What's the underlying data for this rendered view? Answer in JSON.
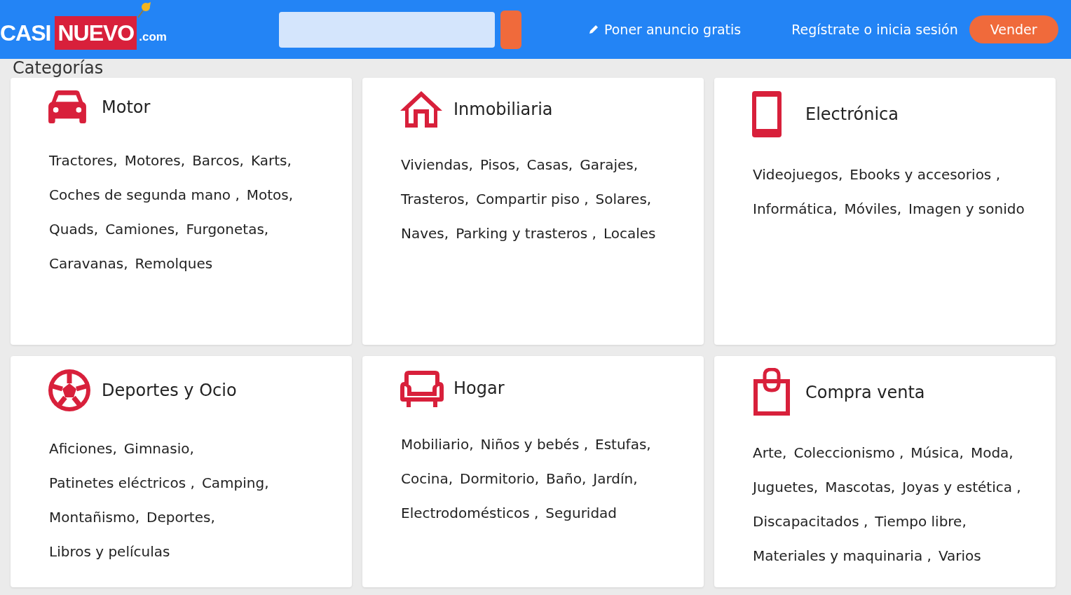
{
  "header": {
    "logo": {
      "first": "CASI",
      "second": "NUEVO",
      "suffix": ".com"
    },
    "post_ad": "Poner anuncio gratis",
    "account": "Regístrate o inicia sesión",
    "sell_button": "Vender"
  },
  "heading": "Categorías",
  "categories": [
    {
      "title": "Motor",
      "items": [
        "Tractores,",
        "Motores,",
        "Barcos,",
        "Karts,",
        "Coches de segunda mano ,",
        "Motos,",
        "Quads,",
        "Camiones,",
        "Furgonetas,",
        "Caravanas,",
        "Remolques"
      ]
    },
    {
      "title": "Inmobiliaria",
      "items": [
        "Viviendas,",
        "Pisos,",
        "Casas,",
        "Garajes,",
        "Trasteros,",
        "Compartir piso ,",
        "Solares,",
        "Naves,",
        "Parking y trasteros ,",
        "Locales"
      ]
    },
    {
      "title": "Electrónica",
      "items": [
        "Videojuegos,",
        "Ebooks y accesorios ,",
        "Informática,",
        "Móviles,",
        "Imagen y sonido"
      ]
    },
    {
      "title": "Deportes y Ocio",
      "items": [
        "Aficiones,",
        "Gimnasio,",
        "Patinetes eléctricos ,",
        "Camping,",
        "Montañismo,",
        "Deportes,",
        "Libros y películas"
      ]
    },
    {
      "title": "Hogar",
      "items": [
        "Mobiliario,",
        "Niños y bebés ,",
        "Estufas,",
        "Cocina,",
        "Dormitorio,",
        "Baño,",
        "Jardín,",
        "Electrodomésticos ,",
        "Seguridad"
      ]
    },
    {
      "title": "Compra venta",
      "items": [
        "Arte,",
        "Coleccionismo ,",
        "Música,",
        "Moda,",
        "Juguetes,",
        "Mascotas,",
        "Joyas y estética ,",
        "Discapacitados ,",
        "Tiempo libre,",
        "Materiales y maquinaria ,",
        "Varios"
      ]
    }
  ]
}
